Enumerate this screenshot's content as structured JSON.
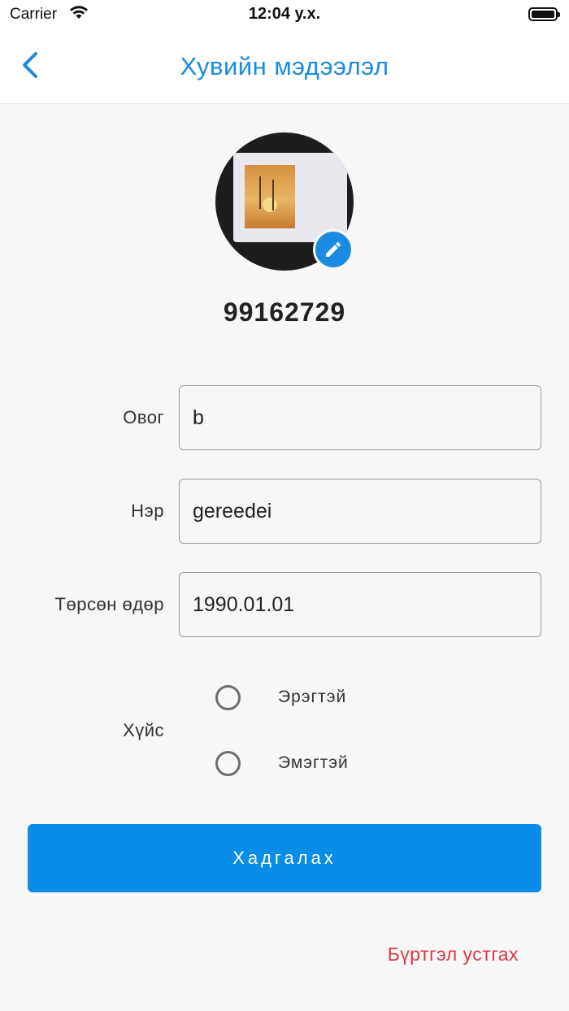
{
  "status_bar": {
    "carrier": "Carrier",
    "time": "12:04 у.х."
  },
  "nav": {
    "title": "Хувийн мэдээлэл",
    "accent_color": "#1a8be0"
  },
  "profile": {
    "phone": "99162729"
  },
  "form": {
    "last_name": {
      "label": "Овог",
      "value": "b"
    },
    "first_name": {
      "label": "Нэр",
      "value": "gereedei"
    },
    "birth_date": {
      "label": "Төрсөн өдөр",
      "value": "1990.01.01"
    },
    "gender": {
      "label": "Хүйс",
      "options": [
        {
          "label": "Эрэгтэй",
          "selected": false
        },
        {
          "label": "Эмэгтэй",
          "selected": false
        }
      ]
    }
  },
  "actions": {
    "save_label": "Хадгалах",
    "delete_label": "Бүртгэл устгах",
    "save_color": "#0a8de6",
    "delete_color": "#d93a45"
  },
  "icons": {
    "back": "chevron-left-icon",
    "edit": "pencil-icon",
    "wifi": "wifi-icon",
    "battery": "battery-icon"
  }
}
